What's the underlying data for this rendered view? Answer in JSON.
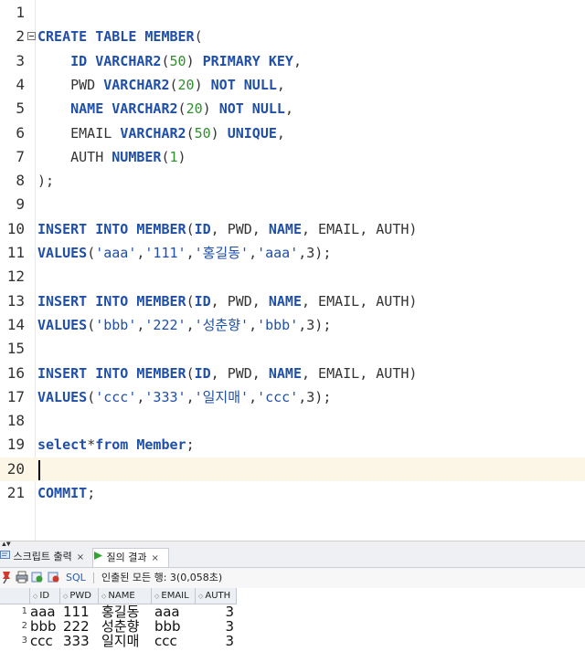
{
  "editor": {
    "lines": [
      {
        "n": "1",
        "html": ""
      },
      {
        "n": "2",
        "html": "<span class=\"kw\">CREATE TABLE MEMBER</span>(",
        "fold": true
      },
      {
        "n": "3",
        "html": "    <span class=\"kw\">ID VARCHAR2</span>(<span class=\"num\">50</span>) <span class=\"kw\">PRIMARY KEY</span>,"
      },
      {
        "n": "4",
        "html": "    PWD <span class=\"kw\">VARCHAR2</span>(<span class=\"num\">20</span>) <span class=\"kw\">NOT NULL</span>,"
      },
      {
        "n": "5",
        "html": "    <span class=\"kw\">NAME VARCHAR2</span>(<span class=\"num\">20</span>) <span class=\"kw\">NOT NULL</span>,"
      },
      {
        "n": "6",
        "html": "    EMAIL <span class=\"kw\">VARCHAR2</span>(<span class=\"num\">50</span>) <span class=\"kw\">UNIQUE</span>,"
      },
      {
        "n": "7",
        "html": "    AUTH <span class=\"kw\">NUMBER</span>(<span class=\"num\">1</span>)"
      },
      {
        "n": "8",
        "html": ");"
      },
      {
        "n": "9",
        "html": ""
      },
      {
        "n": "10",
        "html": "<span class=\"kw\">INSERT INTO MEMBER</span>(<span class=\"kw\">ID</span>, PWD, <span class=\"kw\">NAME</span>, EMAIL, AUTH)"
      },
      {
        "n": "11",
        "html": "<span class=\"kw\">VALUES</span>(<span class=\"str\">'aaa'</span>,<span class=\"str\">'111'</span>,<span class=\"str\">'홍길동'</span>,<span class=\"str\">'aaa'</span>,3);"
      },
      {
        "n": "12",
        "html": ""
      },
      {
        "n": "13",
        "html": "<span class=\"kw\">INSERT INTO MEMBER</span>(<span class=\"kw\">ID</span>, PWD, <span class=\"kw\">NAME</span>, EMAIL, AUTH)"
      },
      {
        "n": "14",
        "html": "<span class=\"kw\">VALUES</span>(<span class=\"str\">'bbb'</span>,<span class=\"str\">'222'</span>,<span class=\"str\">'성춘향'</span>,<span class=\"str\">'bbb'</span>,3);"
      },
      {
        "n": "15",
        "html": ""
      },
      {
        "n": "16",
        "html": "<span class=\"kw\">INSERT INTO MEMBER</span>(<span class=\"kw\">ID</span>, PWD, <span class=\"kw\">NAME</span>, EMAIL, AUTH)"
      },
      {
        "n": "17",
        "html": "<span class=\"kw\">VALUES</span>(<span class=\"str\">'ccc'</span>,<span class=\"str\">'333'</span>,<span class=\"str\">'일지매'</span>,<span class=\"str\">'ccc'</span>,3);"
      },
      {
        "n": "18",
        "html": ""
      },
      {
        "n": "19",
        "html": "<span class=\"kw\">select</span>*<span class=\"kw\">from</span> <span class=\"kw\">Member</span>;"
      },
      {
        "n": "20",
        "html": "",
        "current": true
      },
      {
        "n": "21",
        "html": "<span class=\"kw\">COMMIT</span>;"
      }
    ]
  },
  "output": {
    "tabs": [
      {
        "label": "스크립트 출력",
        "icon": "script-output-icon",
        "close": "×"
      },
      {
        "label": "질의 결과",
        "icon": "run-query-icon",
        "close": "×"
      }
    ],
    "toolbar": {
      "sql_label": "SQL",
      "status": "인출된 모든 행: 3(0,058초)"
    },
    "columns": [
      "ID",
      "PWD",
      "NAME",
      "EMAIL",
      "AUTH"
    ],
    "rows": [
      {
        "n": "1",
        "cells": [
          "aaa",
          "111",
          "홍길동",
          "aaa",
          "3"
        ]
      },
      {
        "n": "2",
        "cells": [
          "bbb",
          "222",
          "성춘향",
          "bbb",
          "3"
        ]
      },
      {
        "n": "3",
        "cells": [
          "ccc",
          "333",
          "일지매",
          "ccc",
          "3"
        ]
      }
    ]
  },
  "colors": {
    "keyword": "#1f4fa8",
    "number": "#2f8f2f",
    "current_line": "#fbf6e6"
  }
}
